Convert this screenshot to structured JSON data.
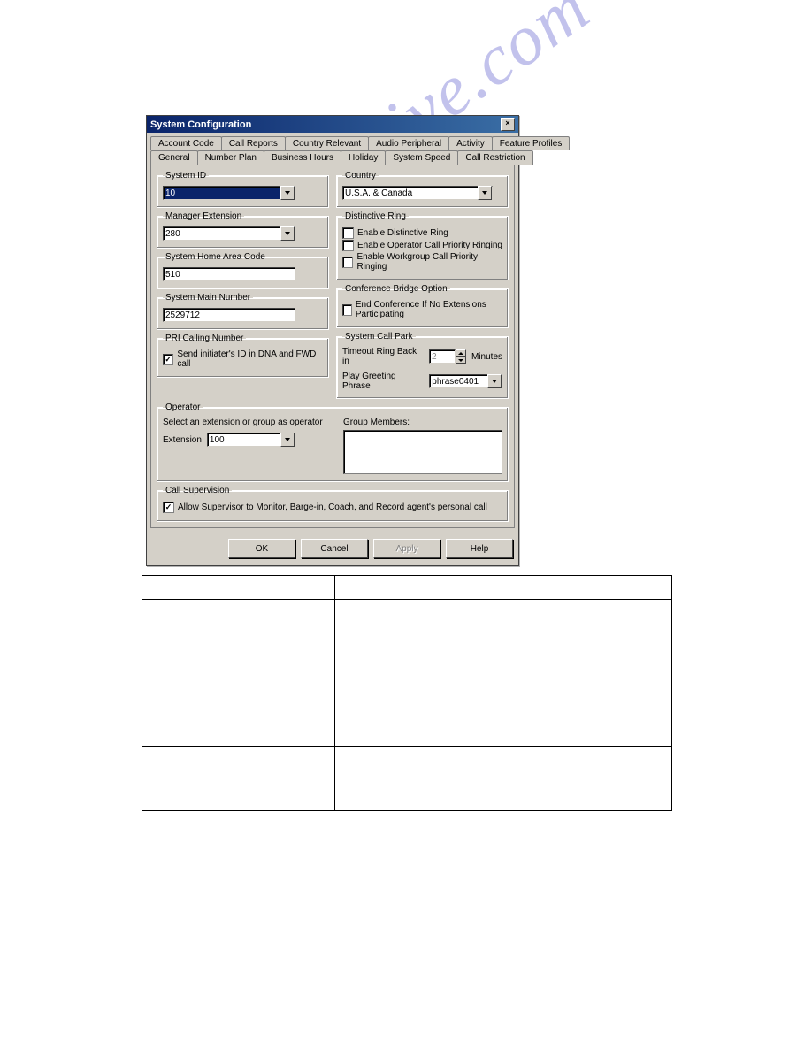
{
  "window": {
    "title": "System Configuration"
  },
  "tabs_row1": [
    "Account Code",
    "Call Reports",
    "Country Relevant",
    "Audio Peripheral",
    "Activity",
    "Feature Profiles"
  ],
  "tabs_row2": [
    "General",
    "Number Plan",
    "Business Hours",
    "Holiday",
    "System Speed",
    "Call Restriction"
  ],
  "active_tab": "General",
  "groups": {
    "system_id": {
      "legend": "System ID",
      "value": "10"
    },
    "manager_ext": {
      "legend": "Manager Extension",
      "value": "280"
    },
    "home_area": {
      "legend": "System Home Area Code",
      "value": "510"
    },
    "main_number": {
      "legend": "System Main Number",
      "value": "2529712"
    },
    "pri": {
      "legend": "PRI Calling Number",
      "check_label": "Send  initiater's ID in DNA and FWD call",
      "checked": true
    },
    "country": {
      "legend": "Country",
      "value": "U.S.A. & Canada"
    },
    "distinctive": {
      "legend": "Distinctive Ring",
      "opts": [
        "Enable Distinctive Ring",
        "Enable Operator Call Priority Ringing",
        "Enable Workgroup Call Priority Ringing"
      ]
    },
    "conf": {
      "legend": "Conference Bridge Option",
      "check_label": "End Conference If No Extensions Participating"
    },
    "callpark": {
      "legend": "System Call Park",
      "timeout_label": "Timeout Ring Back in",
      "timeout_value": "2",
      "timeout_unit": "Minutes",
      "phrase_label": "Play Greeting Phrase",
      "phrase_value": "phrase0401"
    },
    "operator": {
      "legend": "Operator",
      "prompt": "Select an extension or group as operator",
      "ext_label": "Extension",
      "ext_value": "100",
      "members_label": "Group Members:"
    },
    "supervision": {
      "legend": "Call Supervision",
      "check_label": "Allow Supervisor to Monitor, Barge-in, Coach, and Record agent's personal call",
      "checked": true
    }
  },
  "buttons": {
    "ok": "OK",
    "cancel": "Cancel",
    "apply": "Apply",
    "help": "Help"
  },
  "watermark": "manualshive.com"
}
